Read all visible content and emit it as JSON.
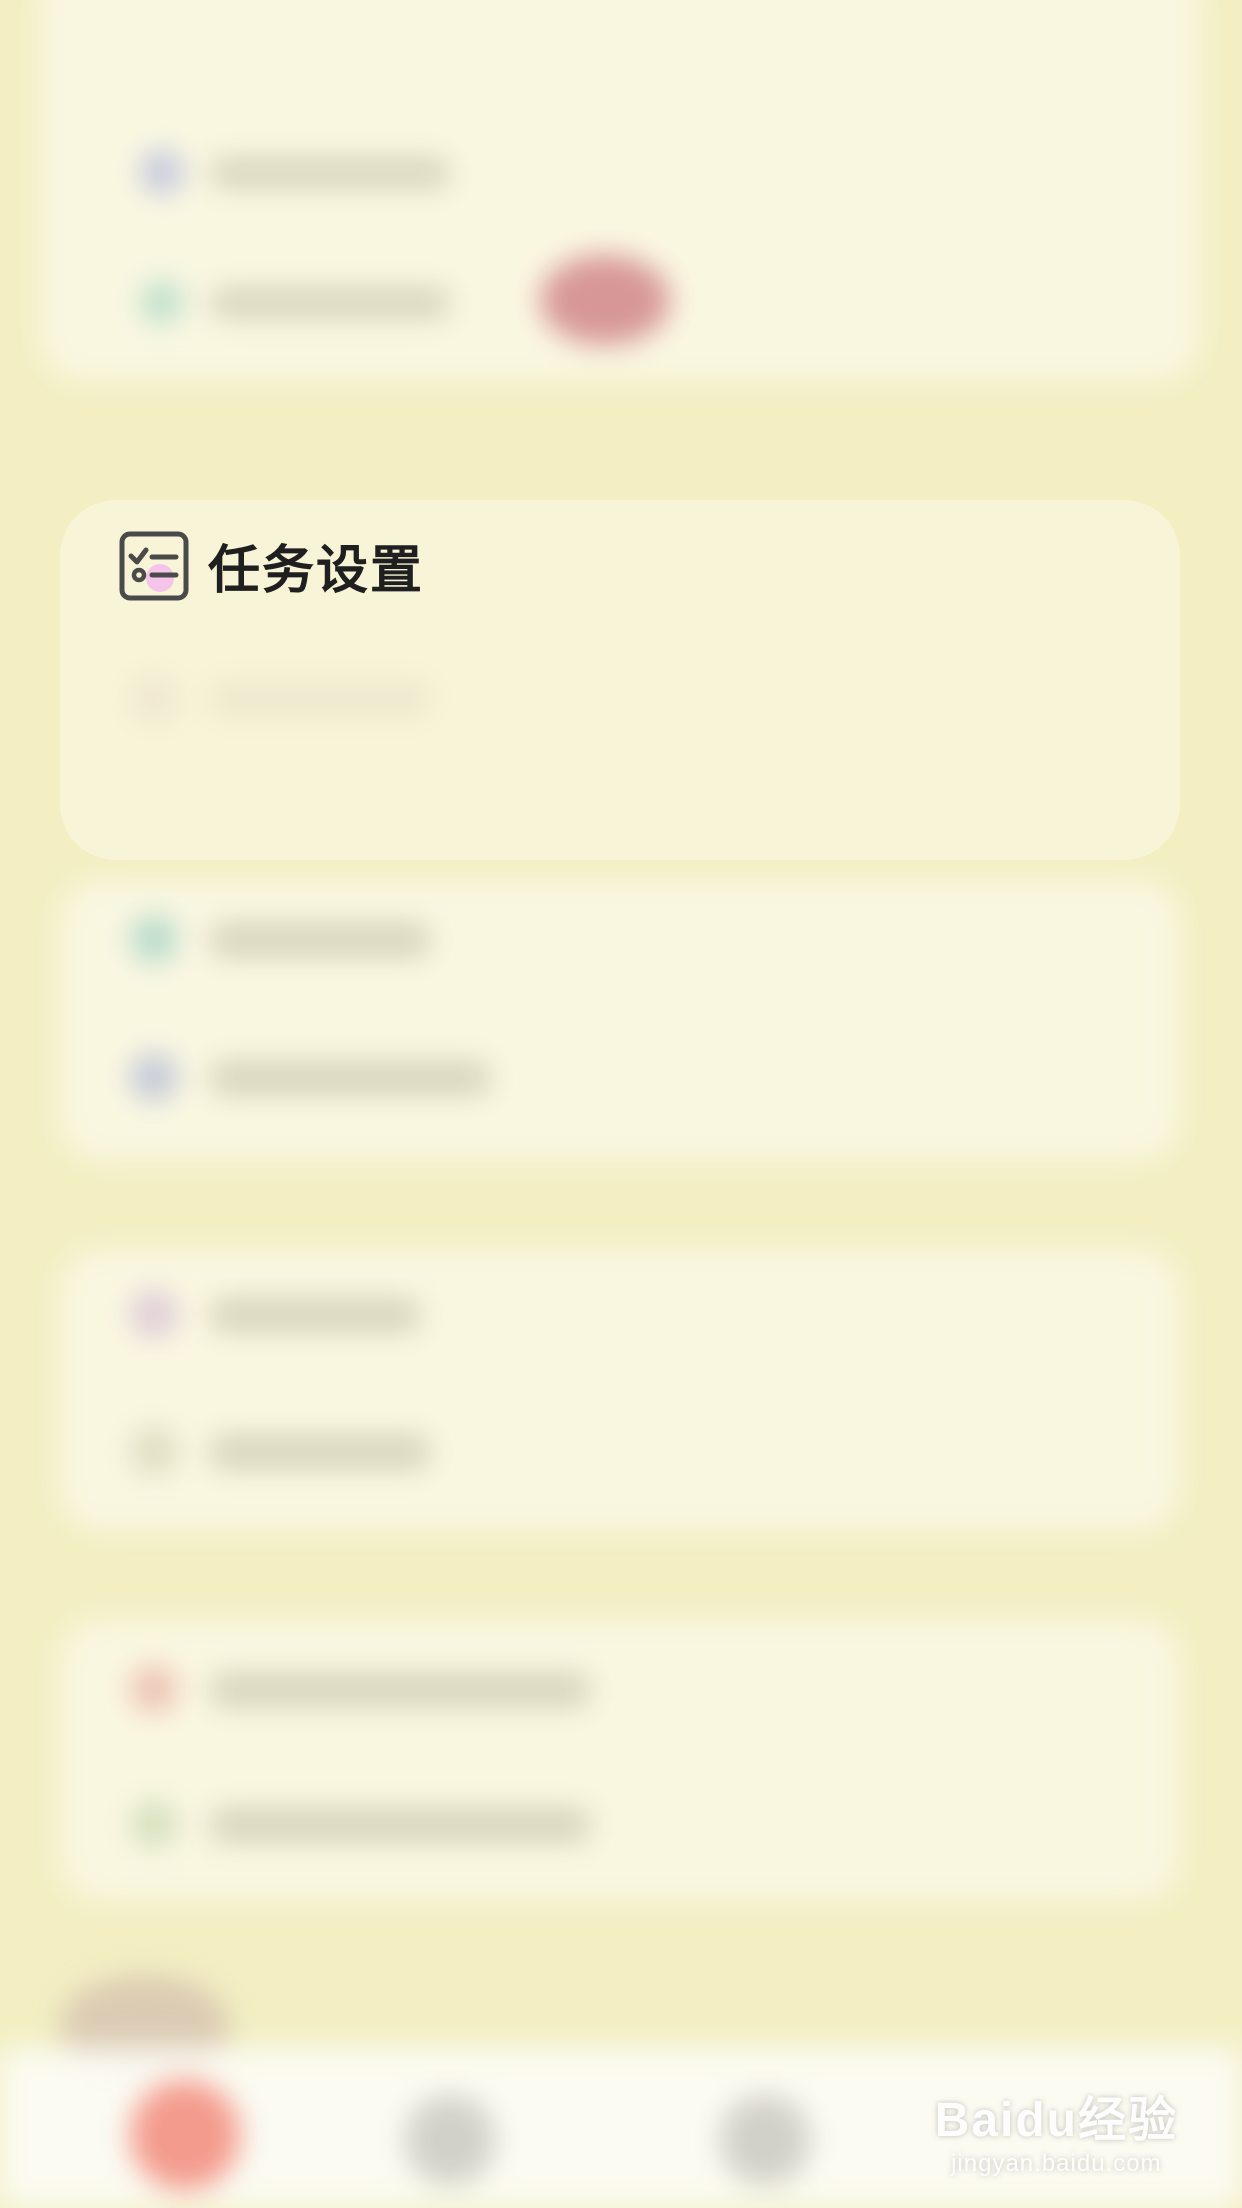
{
  "task_settings": {
    "title": "任务设置",
    "icon": "checklist-icon"
  },
  "watermark": {
    "brand": "Baidu经验",
    "url": "jingyan.baidu.com"
  },
  "colors": {
    "background": "#f3efc3",
    "title_text": "#1f1f1f",
    "icon_accent": "#f5b8f0",
    "fab_red": "#f08a7a"
  }
}
